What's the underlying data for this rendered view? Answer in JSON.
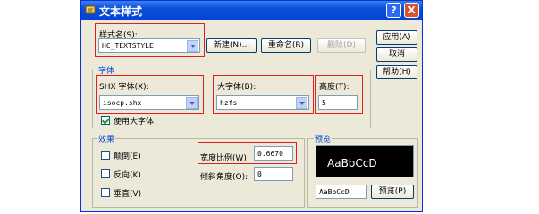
{
  "window": {
    "title": "文本样式",
    "help_glyph": "?",
    "close_glyph": "X"
  },
  "style_name": {
    "label": "样式名(S):",
    "value": "HC_TEXTSTYLE",
    "new_button": "新建(N)...",
    "rename_button": "重命名(R)",
    "delete_button": "删除(D)"
  },
  "side_buttons": {
    "apply": "应用(A)",
    "cancel": "取消",
    "help": "帮助(H)"
  },
  "font": {
    "group_label": "字体",
    "shx_label": "SHX 字体(X):",
    "shx_value": "isocp.shx",
    "big_font_label": "大字体(B):",
    "big_font_value": "hzfs",
    "height_label": "高度(T):",
    "height_value": "5",
    "use_big_font_label": "使用大字体",
    "use_big_font_checked": true
  },
  "effects": {
    "group_label": "效果",
    "upside_down_label": "颠倒(E)",
    "backwards_label": "反向(K)",
    "vertical_label": "垂直(V)",
    "width_factor_label": "宽度比例(W):",
    "width_factor_value": "0.6670",
    "oblique_label": "倾斜角度(O):",
    "oblique_value": "0"
  },
  "preview": {
    "group_label": "预览",
    "sample_text": "_AaBbCcD",
    "cursor_text": "_",
    "input_value": "AaBbCcD",
    "button": "预览(P)"
  }
}
